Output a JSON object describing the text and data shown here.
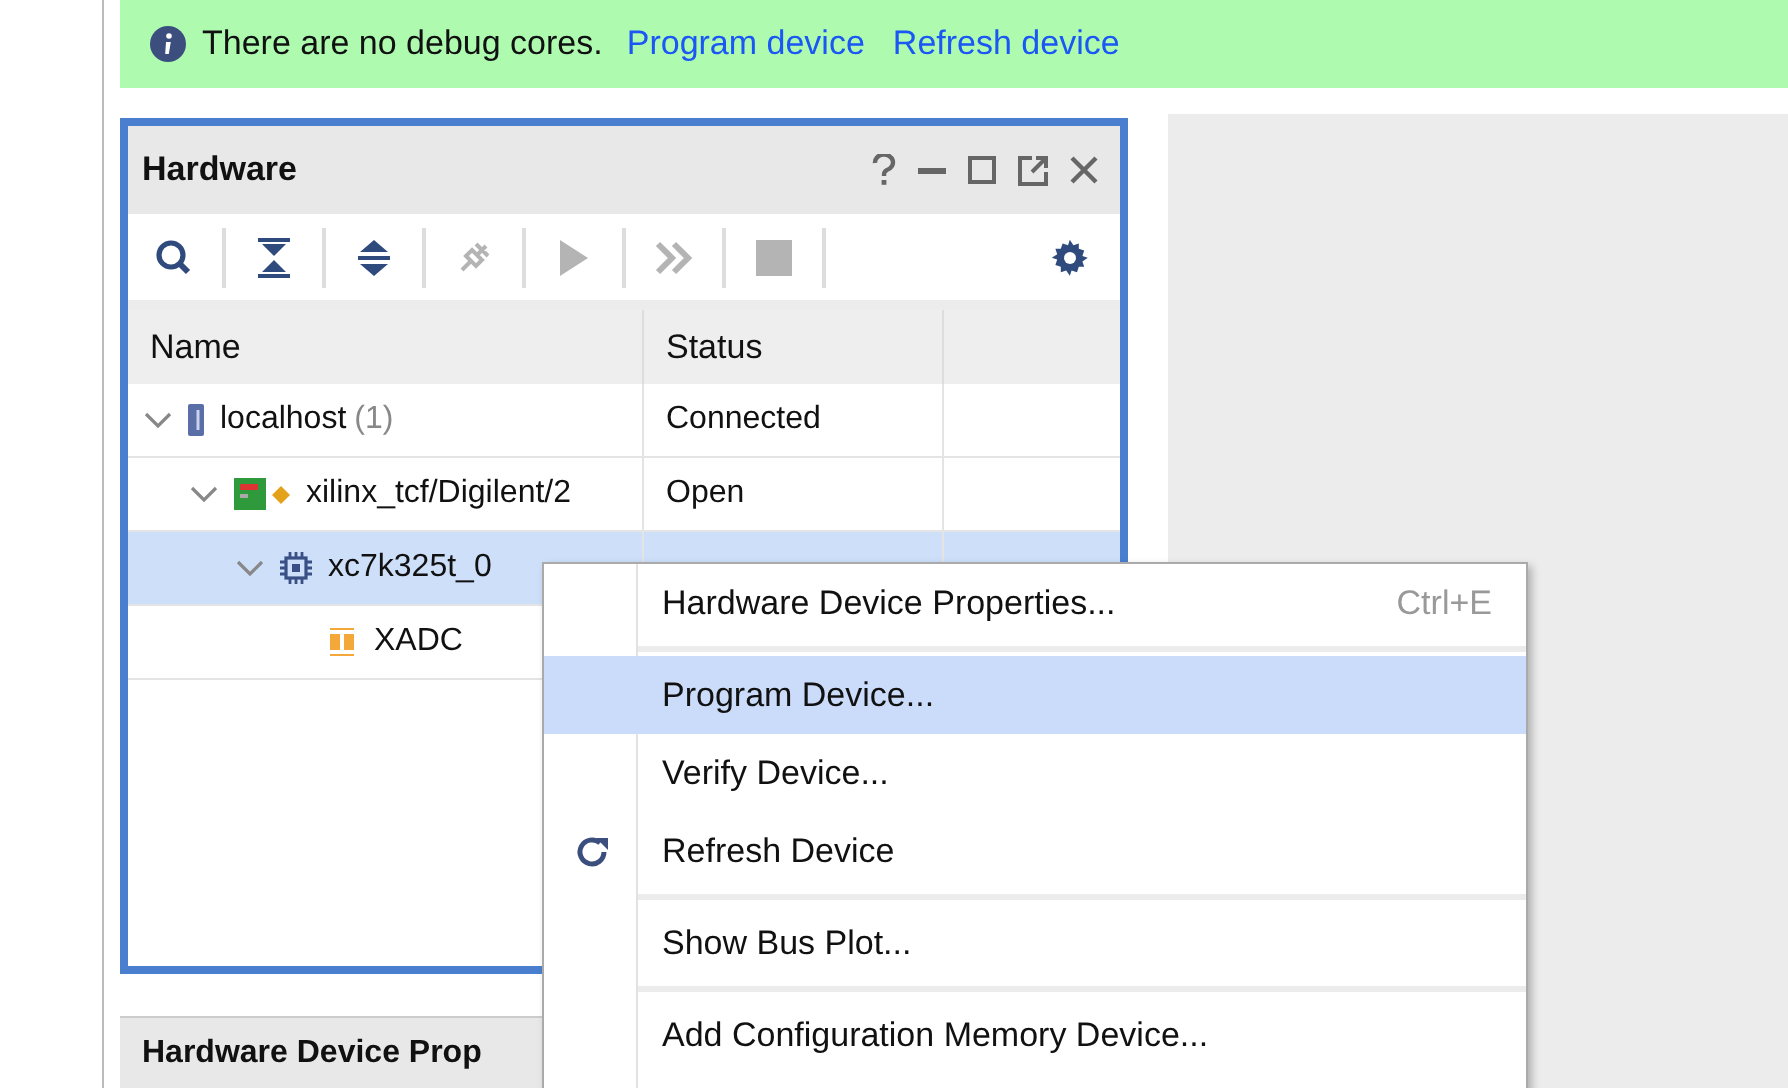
{
  "banner": {
    "message": "There are no debug cores.",
    "links": [
      "Program device",
      "Refresh device"
    ]
  },
  "hardware_panel": {
    "title": "Hardware",
    "toolbar": [
      {
        "kind": "search",
        "disabled": false
      },
      {
        "kind": "collapse",
        "disabled": false
      },
      {
        "kind": "expand",
        "disabled": false
      },
      {
        "kind": "connect",
        "disabled": true
      },
      {
        "kind": "run",
        "disabled": true
      },
      {
        "kind": "run-all",
        "disabled": true
      },
      {
        "kind": "stop",
        "disabled": true
      },
      {
        "kind": "settings",
        "disabled": false
      }
    ],
    "columns": [
      "Name",
      "Status"
    ],
    "tree": [
      {
        "kind": "server",
        "name": "localhost",
        "count": "(1)",
        "status": "Connected",
        "expanded": true,
        "selected": false,
        "children": [
          {
            "kind": "board",
            "name": "xilinx_tcf/Digilent/2",
            "status": "Open",
            "expanded": true,
            "selected": false,
            "children": [
              {
                "kind": "chip",
                "name": "xc7k325t_0",
                "expanded": true,
                "selected": true,
                "children": [
                  {
                    "kind": "sysmon",
                    "name": "XADC",
                    "selected": false
                  }
                ]
              }
            ]
          }
        ]
      }
    ]
  },
  "bottom_panel": {
    "title": "Hardware Device Prop"
  },
  "context_menu": [
    {
      "kind": "item",
      "label": "Hardware Device Properties...",
      "shortcut": "Ctrl+E",
      "selected": false
    },
    {
      "kind": "separator"
    },
    {
      "kind": "item",
      "label": "Program Device...",
      "selected": true
    },
    {
      "kind": "item",
      "label": "Verify Device...",
      "selected": false
    },
    {
      "kind": "refresh",
      "label": "Refresh Device",
      "selected": false
    },
    {
      "kind": "separator"
    },
    {
      "kind": "item",
      "label": "Show Bus Plot...",
      "selected": false
    },
    {
      "kind": "separator"
    },
    {
      "kind": "item",
      "label": "Add Configuration Memory Device...",
      "selected": false
    }
  ]
}
